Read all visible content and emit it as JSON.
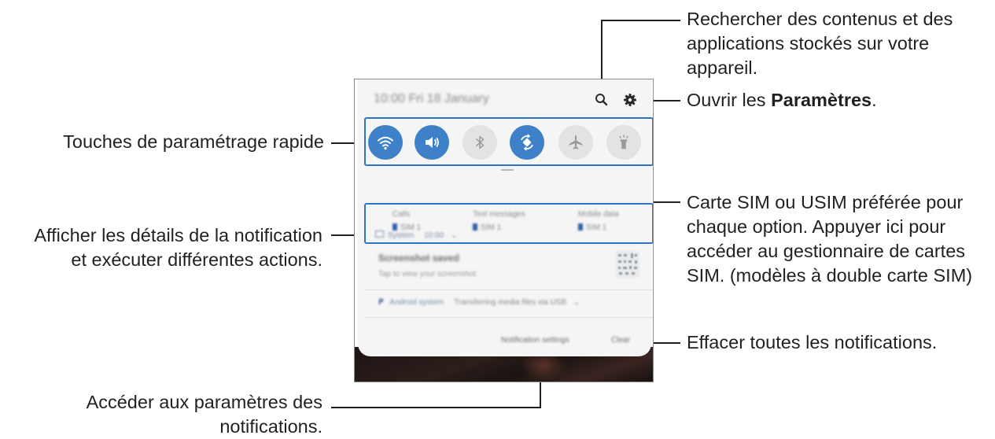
{
  "callouts": {
    "search": [
      "Rechercher des contenus et des",
      "applications stockés sur votre",
      "appareil."
    ],
    "settings_prefix": "Ouvrir les ",
    "settings_bold": "Paramètres",
    "settings_suffix": ".",
    "quick_settings": "Touches de paramétrage rapide",
    "sim": [
      "Carte SIM ou USIM préférée pour",
      "chaque option. Appuyer ici pour",
      "accéder au gestionnaire de cartes",
      "SIM. (modèles à double carte SIM)"
    ],
    "details": [
      "Afficher les détails de la notification",
      "et exécuter différentes actions."
    ],
    "clear": "Effacer toutes les notifications.",
    "notif_settings": [
      "Accéder aux paramètres des",
      "notifications."
    ]
  },
  "phone": {
    "status_time": "10:00  Fri 18 January",
    "quick_buttons": [
      {
        "icon": "wifi-icon",
        "state": "on"
      },
      {
        "icon": "sound-icon",
        "state": "on"
      },
      {
        "icon": "bluetooth-icon",
        "state": "off"
      },
      {
        "icon": "auto-rotate-icon",
        "state": "on"
      },
      {
        "icon": "airplane-icon",
        "state": "off"
      },
      {
        "icon": "flashlight-icon",
        "state": "off"
      }
    ],
    "sim_options": [
      {
        "label": "Calls",
        "sim": "SIM 1"
      },
      {
        "label": "Text messages",
        "sim": "SIM 1"
      },
      {
        "label": "Mobile data",
        "sim": "SIM 1"
      }
    ],
    "notification": {
      "app": "System",
      "time": "10:00",
      "title": "Screenshot saved",
      "subtitle": "Tap to view your screenshot"
    },
    "android_row": {
      "app": "Android system",
      "text": "Transferring media files via USB"
    },
    "notification_settings": "Notification settings",
    "clear": "Clear"
  },
  "colors": {
    "accent": "#3e81c8",
    "highlight_border": "#2f74c0",
    "text": "#231f20"
  }
}
